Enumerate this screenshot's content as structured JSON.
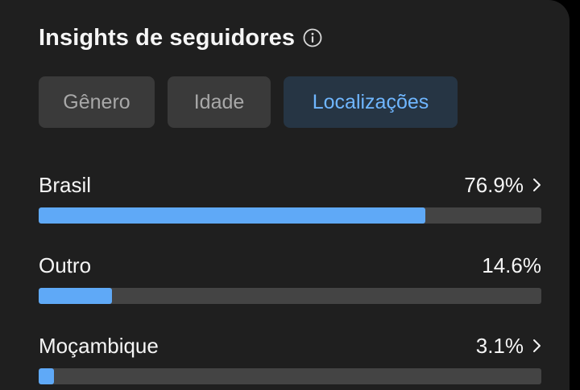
{
  "header": {
    "title": "Insights de seguidores",
    "info_icon": "info-circle-icon"
  },
  "tabs": [
    {
      "label": "Gênero",
      "active": false
    },
    {
      "label": "Idade",
      "active": false
    },
    {
      "label": "Localizações",
      "active": true
    }
  ],
  "locations": [
    {
      "name": "Brasil",
      "percent_label": "76.9%",
      "percent": 76.9,
      "has_chevron": true
    },
    {
      "name": "Outro",
      "percent_label": "14.6%",
      "percent": 14.6,
      "has_chevron": false
    },
    {
      "name": "Moçambique",
      "percent_label": "3.1%",
      "percent": 3.1,
      "has_chevron": true
    }
  ],
  "colors": {
    "background": "#1f1f1f",
    "bar_fill": "#5fa9f7",
    "bar_track": "#444444",
    "active_tab_bg": "#263544",
    "active_tab_text": "#6fb6ff"
  }
}
